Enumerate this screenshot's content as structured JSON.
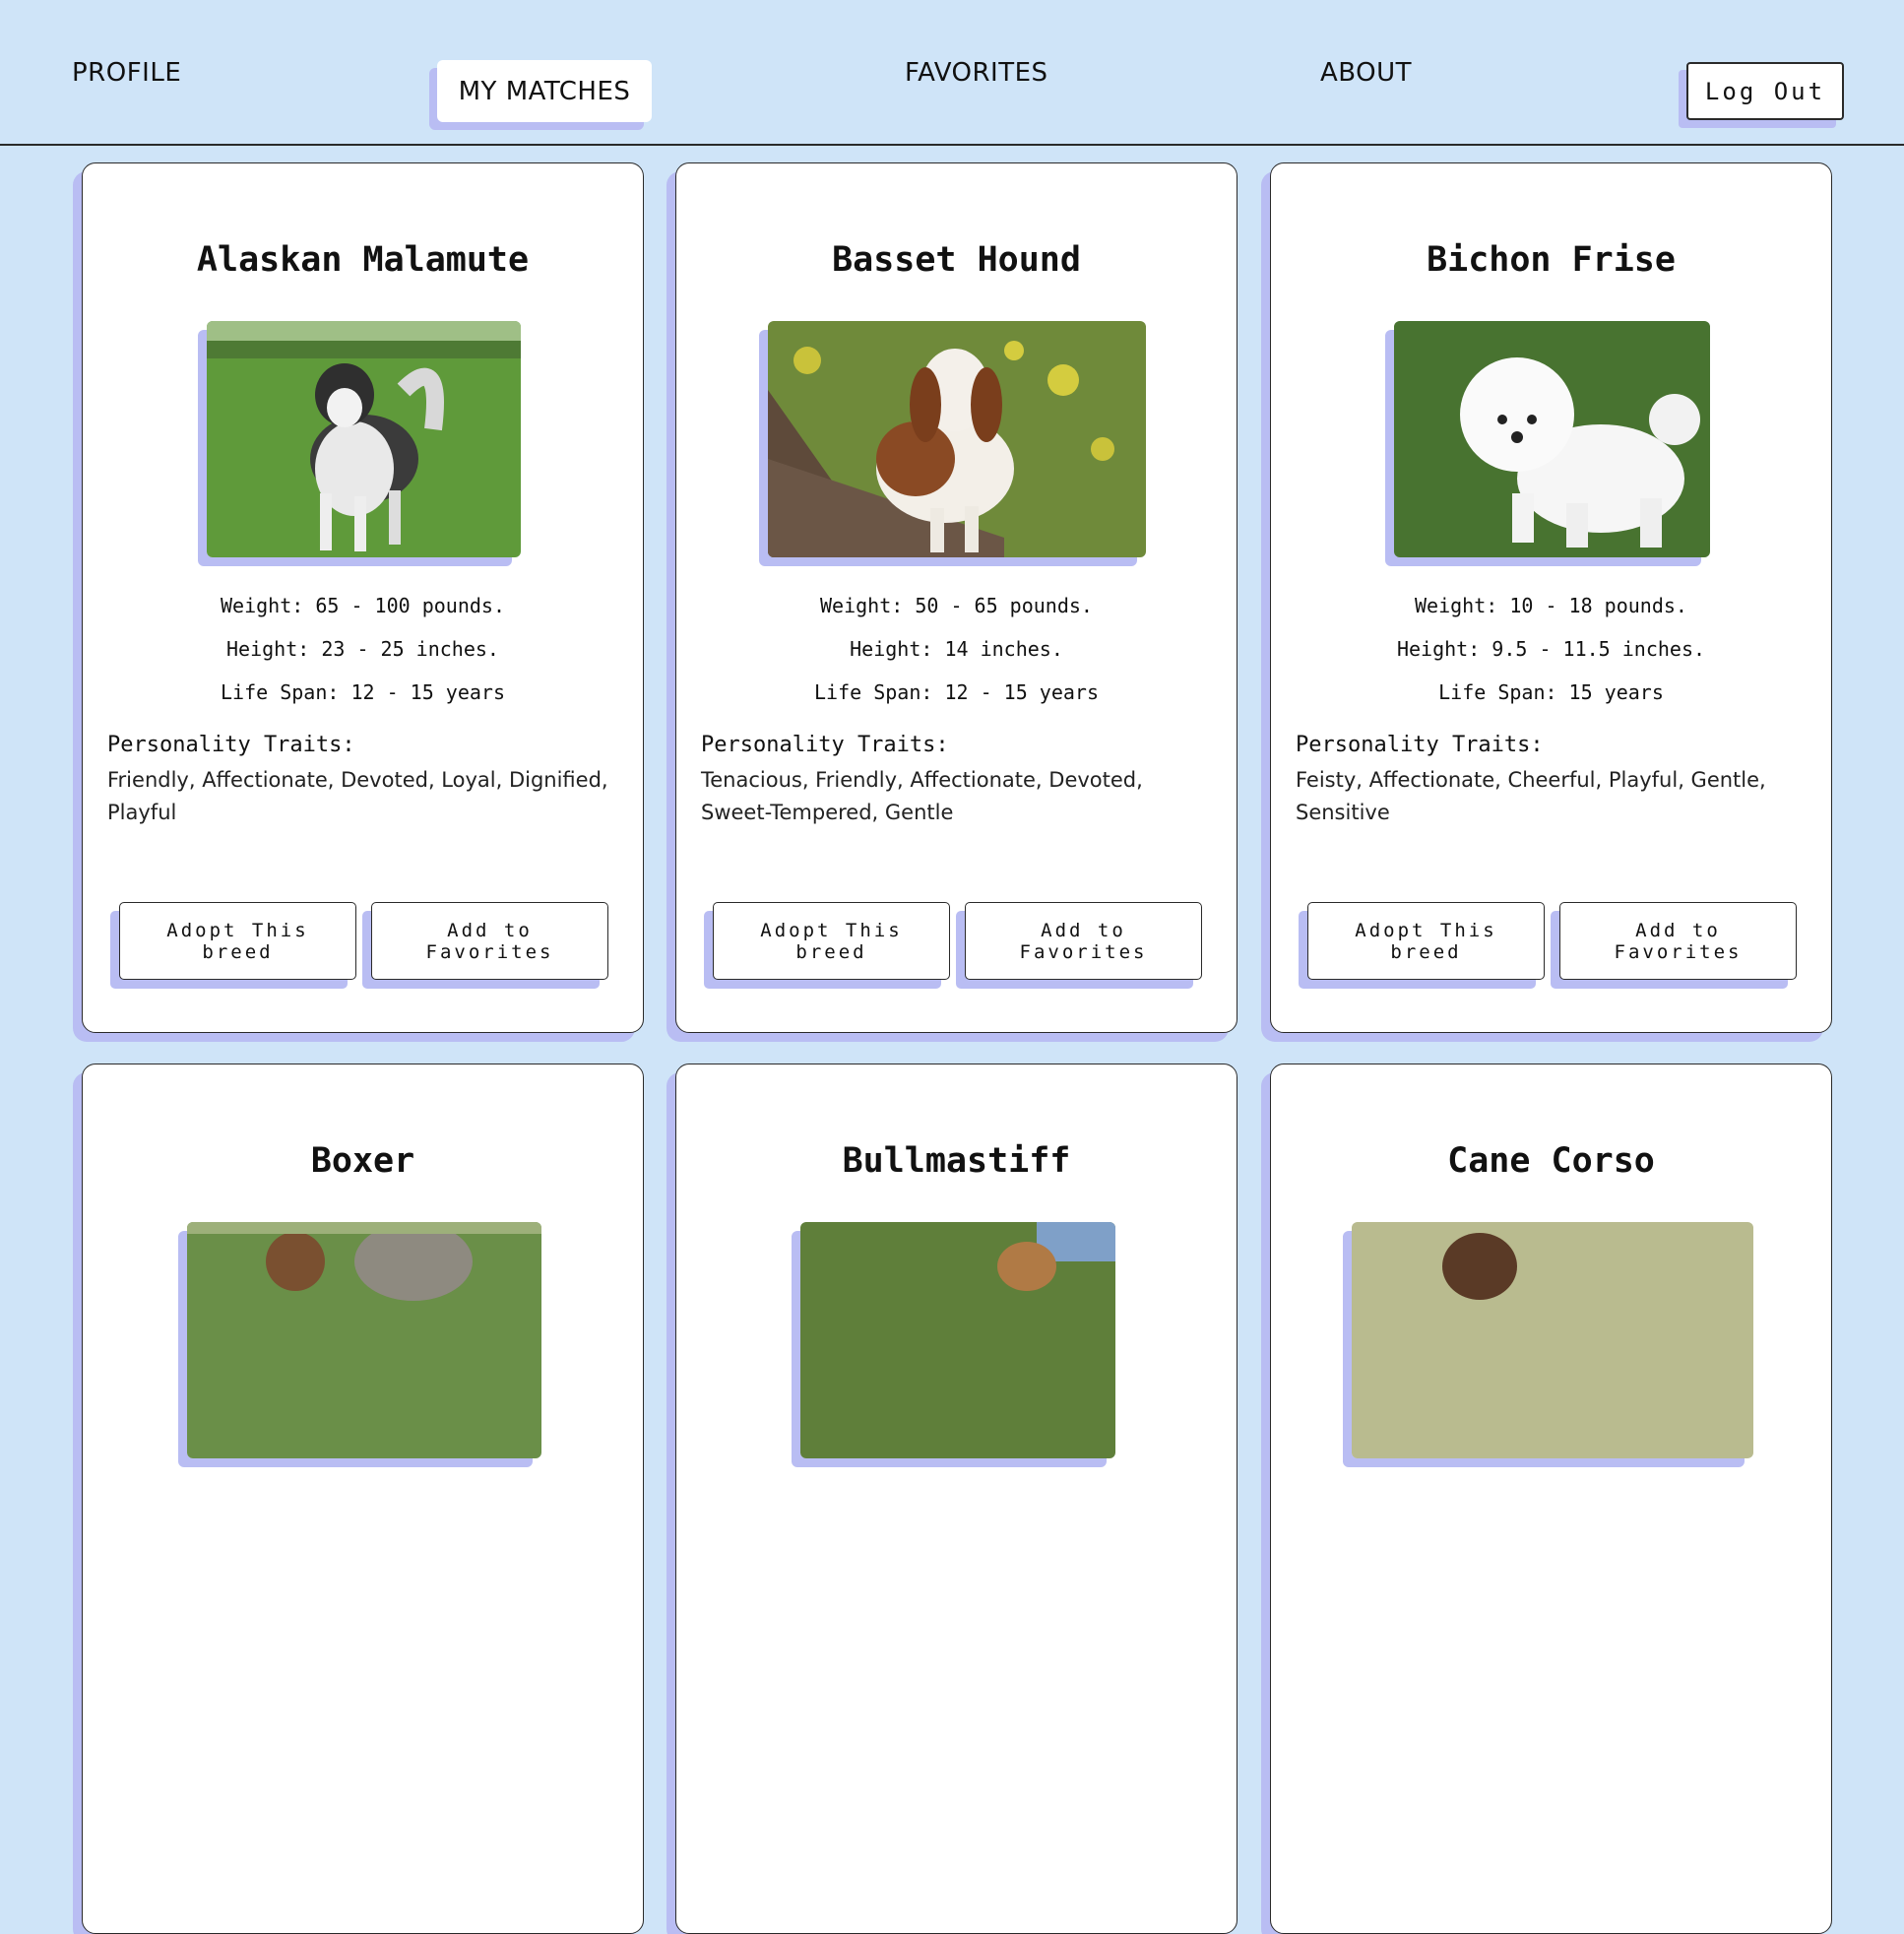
{
  "nav": {
    "profile": "PROFILE",
    "my_matches": "MY MATCHES",
    "favorites": "FAVORITES",
    "about": "ABOUT",
    "logout": "Log Out"
  },
  "cards": [
    {
      "name": "Alaskan Malamute",
      "weight": "Weight: 65 - 100 pounds.",
      "height": "Height: 23 - 25 inches.",
      "life_span": "Life Span: 12 - 15 years",
      "traits_label": "Personality Traits:",
      "traits": "Friendly, Affectionate, Devoted, Loyal, Dignified, Playful",
      "adopt_label": "Adopt This breed",
      "favorite_label": "Add to Favorites"
    },
    {
      "name": "Basset Hound",
      "weight": "Weight: 50 - 65 pounds.",
      "height": "Height: 14 inches.",
      "life_span": "Life Span: 12 - 15 years",
      "traits_label": "Personality Traits:",
      "traits": "Tenacious, Friendly, Affectionate, Devoted, Sweet-Tempered, Gentle",
      "adopt_label": "Adopt This breed",
      "favorite_label": "Add to Favorites"
    },
    {
      "name": "Bichon Frise",
      "weight": "Weight: 10 - 18 pounds.",
      "height": "Height: 9.5 - 11.5 inches.",
      "life_span": "Life Span: 15 years",
      "traits_label": "Personality Traits:",
      "traits": "Feisty, Affectionate, Cheerful, Playful, Gentle, Sensitive",
      "adopt_label": "Adopt This breed",
      "favorite_label": "Add to Favorites"
    },
    {
      "name": "Boxer"
    },
    {
      "name": "Bullmastiff"
    },
    {
      "name": "Cane Corso"
    }
  ],
  "colors": {
    "page_background": "#cfe4f8",
    "shadow_accent": "#b9bdf3",
    "card_background": "#ffffff"
  }
}
